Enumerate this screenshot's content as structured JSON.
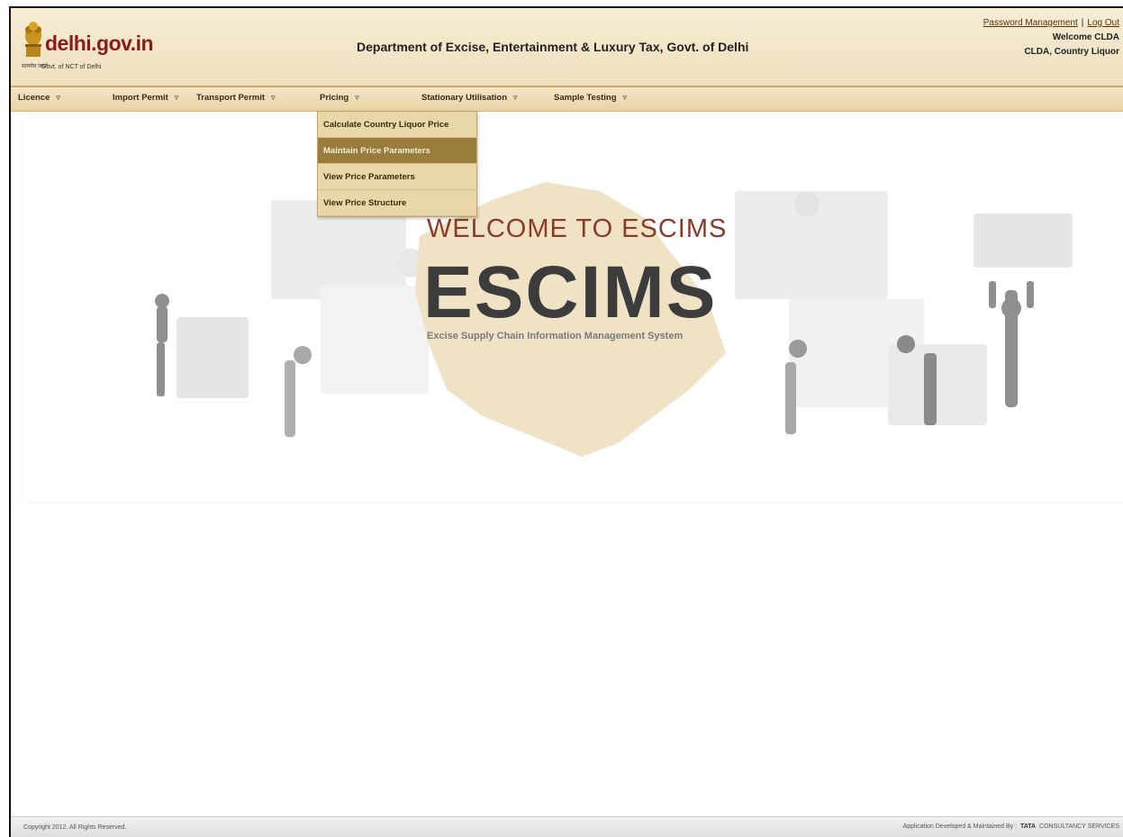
{
  "header": {
    "logo_text": "delhi.gov.in",
    "logo_hindi": "सत्यमेव जयते",
    "logo_sub": "Govt. of NCT of Delhi",
    "title": "Department of Excise, Entertainment & Luxury Tax, Govt. of Delhi",
    "password_link": "Password Management",
    "separator": "|",
    "logout_link": "Log Out",
    "welcome_text": "Welcome CLDA",
    "role_text": "CLDA, Country Liquor"
  },
  "menu": {
    "items": [
      {
        "label": "Licence"
      },
      {
        "label": "Import Permit"
      },
      {
        "label": "Transport Permit"
      },
      {
        "label": "Pricing"
      },
      {
        "label": "Stationary Utilisation"
      },
      {
        "label": "Sample Testing"
      }
    ],
    "pricing_dropdown": [
      {
        "label": "Calculate Country Liquor Price"
      },
      {
        "label": "Maintain Price Parameters"
      },
      {
        "label": "View Price Parameters"
      },
      {
        "label": "View Price Structure"
      }
    ]
  },
  "banner": {
    "welcome": "WELCOME TO ESCIMS",
    "acronym": "ESCIMS",
    "full_name": "Excise Supply Chain Information Management System"
  },
  "footer": {
    "copyright": "Copyright 2012. All Rights Reserved.",
    "developed_by": "Application Developed & Maintained By :",
    "brand": "TATA",
    "company": "CONSULTANCY SERVICES"
  },
  "colors": {
    "header_bg": "#efe0bd",
    "menu_active": "#9a7c3c",
    "title_red": "#8a3b2c",
    "logo_red": "#8b1a1a"
  }
}
